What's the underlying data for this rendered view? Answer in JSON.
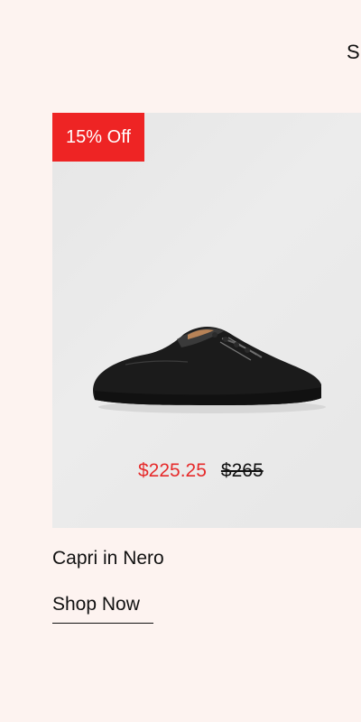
{
  "header": {
    "next_title_partial": "S"
  },
  "product": {
    "badge": "15% Off",
    "sale_price": "$225.25",
    "original_price": "$265",
    "name": "Capri in Nero",
    "cta_label": "Shop Now"
  },
  "colors": {
    "background": "#fdf3f0",
    "badge": "#ee2424",
    "sale_price": "#e62b2b",
    "text": "#111111"
  }
}
